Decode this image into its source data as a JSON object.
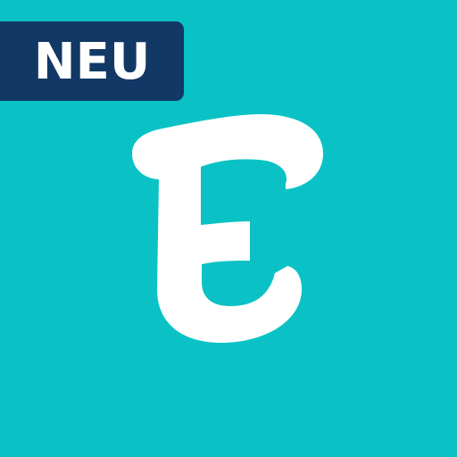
{
  "app_icon": {
    "background_color": "#0AC2C5",
    "logo": {
      "name": "eventbrite-e-logo",
      "color": "#FFFFFF"
    },
    "badge": {
      "label": "NEU",
      "background_color": "#123966",
      "text_color": "#FFFFFF"
    }
  }
}
